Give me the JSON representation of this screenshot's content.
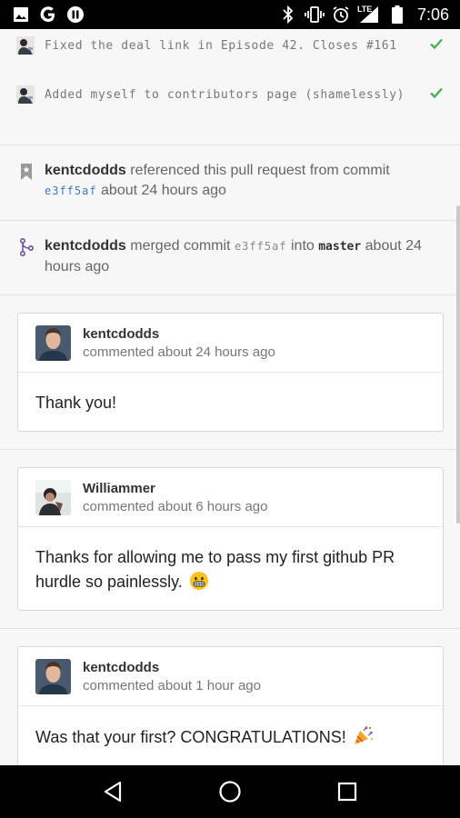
{
  "status_bar": {
    "time": "7:06",
    "network": "LTE",
    "left_icons": [
      "image-icon",
      "google-icon",
      "pause-icon"
    ],
    "right_icons": [
      "bluetooth-icon",
      "vibrate-icon",
      "alarm-icon",
      "signal-icon",
      "battery-icon"
    ]
  },
  "commits": [
    {
      "message": "Fixed the deal link in Episode 42. Closes #161",
      "status": "success-check-icon"
    },
    {
      "message": "Added myself to contributors page (shamelessly)",
      "status": "success-check-icon"
    }
  ],
  "events": [
    {
      "icon": "bookmark-icon",
      "actor": "kentcdodds",
      "text1": "referenced this pull request from commit",
      "sha": "e3ff5af",
      "text2": "about 24 hours ago"
    },
    {
      "icon": "merge-icon",
      "actor": "kentcdodds",
      "text1": "merged commit",
      "sha": "e3ff5af",
      "text_into": "into",
      "branch": "master",
      "text2": "about 24 hours ago"
    }
  ],
  "comments": [
    {
      "author": "kentcdodds",
      "time": "commented about 24 hours ago",
      "body": "Thank you!",
      "emoji": ""
    },
    {
      "author": "Williammer",
      "time": "commented about 6 hours ago",
      "body": "Thanks for allowing me to pass my first github PR hurdle so painlessly.",
      "emoji": "grinning-emoji"
    },
    {
      "author": "kentcdodds",
      "time": "commented about 1 hour ago",
      "body": "Was that your first? CONGRATULATIONS!",
      "emoji": "party-popper-emoji"
    }
  ],
  "nav": [
    "back-icon",
    "home-icon",
    "recents-icon"
  ],
  "colors": {
    "success": "#4cb04c",
    "link": "#4078c0",
    "merge": "#6e5494"
  }
}
